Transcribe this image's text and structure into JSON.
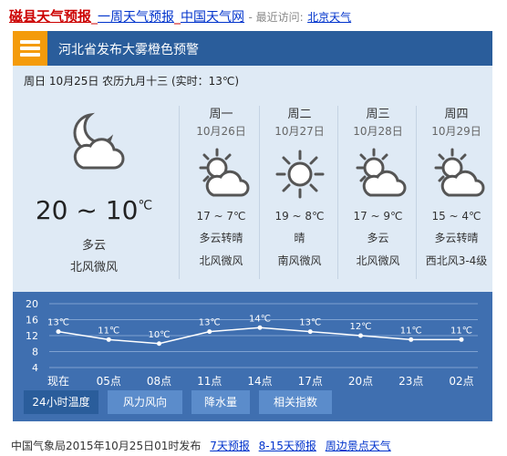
{
  "header": {
    "title_links": [
      "磁县天气预报",
      "一周天气预报",
      "中国天气网"
    ],
    "separator": "_",
    "recent_label": "- 最近访问:",
    "recent_link": "北京天气"
  },
  "alert": "河北省发布大雾橙色预警",
  "dateline": "周日 10月25日 农历九月十三 (实时：13℃)",
  "today": {
    "temp": "20 ~ 10",
    "unit": "℃",
    "desc": "多云",
    "wind": "北风微风",
    "icon": "cloud-moon-icon"
  },
  "days": [
    {
      "week": "周一",
      "date": "10月26日",
      "temp": "17 ~ 7℃",
      "desc": "多云转晴",
      "wind": "北风微风",
      "icon": "sun-cloud-icon"
    },
    {
      "week": "周二",
      "date": "10月27日",
      "temp": "19 ~ 8℃",
      "desc": "晴",
      "wind": "南风微风",
      "icon": "sun-icon"
    },
    {
      "week": "周三",
      "date": "10月28日",
      "temp": "17 ~ 9℃",
      "desc": "多云",
      "wind": "北风微风",
      "icon": "sun-cloud-icon"
    },
    {
      "week": "周四",
      "date": "10月29日",
      "temp": "15 ~ 4℃",
      "desc": "多云转晴",
      "wind": "西北风3-4级",
      "icon": "sun-cloud-icon"
    }
  ],
  "chart_data": {
    "type": "line",
    "categories": [
      "现在",
      "05点",
      "08点",
      "11点",
      "14点",
      "17点",
      "20点",
      "23点",
      "02点"
    ],
    "series": [
      {
        "values": [
          13,
          11,
          10,
          13,
          14,
          13,
          12,
          11,
          11
        ]
      }
    ],
    "data_labels": [
      "13℃",
      "11℃",
      "10℃",
      "13℃",
      "14℃",
      "13℃",
      "12℃",
      "11℃",
      "11℃"
    ],
    "y_ticks": [
      "20",
      "16",
      "12",
      "8",
      "4"
    ],
    "ylim": [
      4,
      20
    ],
    "grid": true,
    "colors": {
      "background": "#3f6fb0",
      "line": "#ffffff"
    }
  },
  "tabs": [
    "24小时温度",
    "风力风向",
    "降水量",
    "相关指数"
  ],
  "footer": {
    "text": "中国气象局2015年10月25日01时发布",
    "links": [
      "7天预报",
      "8-15天预报",
      "周边景点天气"
    ]
  }
}
